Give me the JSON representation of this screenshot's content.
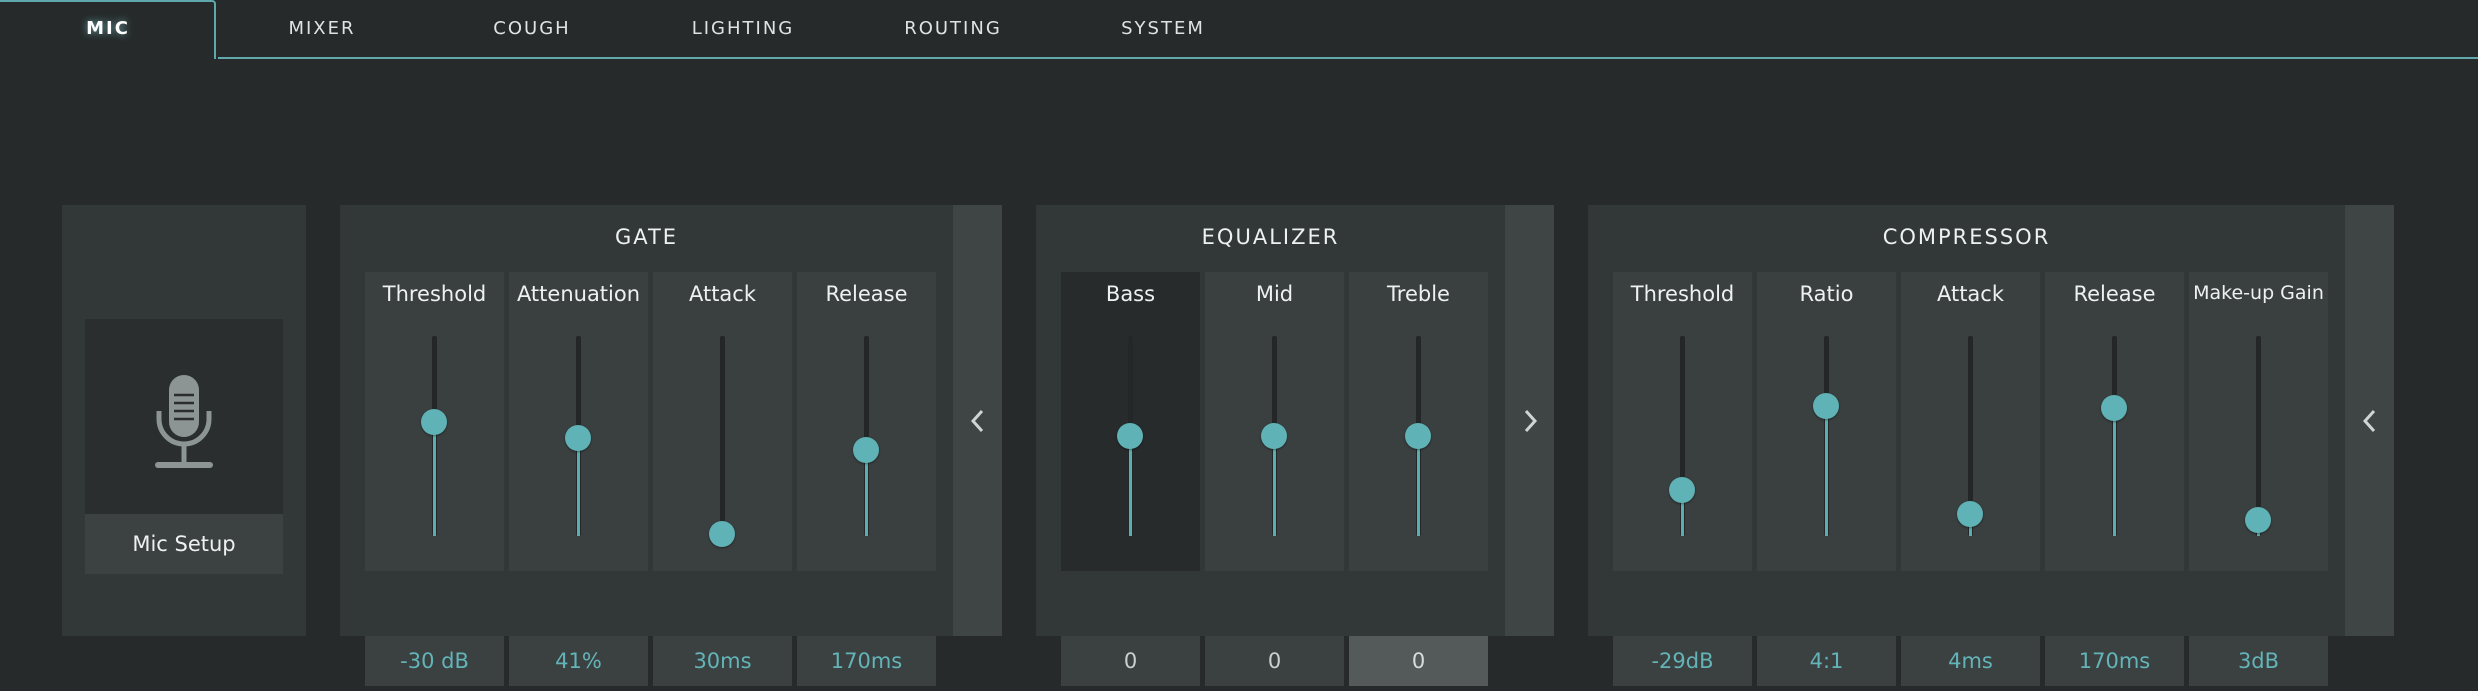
{
  "tabs": [
    {
      "label": "MIC",
      "active": true
    },
    {
      "label": "MIXER",
      "active": false
    },
    {
      "label": "COUGH",
      "active": false
    },
    {
      "label": "LIGHTING",
      "active": false
    },
    {
      "label": "ROUTING",
      "active": false
    },
    {
      "label": "SYSTEM",
      "active": false
    }
  ],
  "mic": {
    "setup_label": "Mic Setup",
    "icon": "microphone-icon"
  },
  "gate": {
    "title": "GATE",
    "collapse_icon": "chevron-left-icon",
    "controls": [
      {
        "label": "Threshold",
        "value": "-30 dB",
        "level": 0.57
      },
      {
        "label": "Attenuation",
        "value": "41%",
        "level": 0.49
      },
      {
        "label": "Attack",
        "value": "30ms",
        "level": 0.01
      },
      {
        "label": "Release",
        "value": "170ms",
        "level": 0.43
      }
    ]
  },
  "equalizer": {
    "title": "EQUALIZER",
    "expand_icon": "chevron-right-icon",
    "controls": [
      {
        "label": "Bass",
        "value": "0",
        "level": 0.5
      },
      {
        "label": "Mid",
        "value": "0",
        "level": 0.5
      },
      {
        "label": "Treble",
        "value": "0",
        "level": 0.5
      }
    ]
  },
  "compressor": {
    "title": "COMPRESSOR",
    "collapse_icon": "chevron-left-icon",
    "controls": [
      {
        "label": "Threshold",
        "value": "-29dB",
        "level": 0.23
      },
      {
        "label": "Ratio",
        "value": "4:1",
        "level": 0.65
      },
      {
        "label": "Attack",
        "value": "4ms",
        "level": 0.11
      },
      {
        "label": "Release",
        "value": "170ms",
        "level": 0.64
      },
      {
        "label": "Make-up Gain",
        "value": "3dB",
        "level": 0.08
      }
    ]
  },
  "colors": {
    "accent": "#5fb2b6",
    "background": "#262a2a",
    "panel": "#323737"
  }
}
